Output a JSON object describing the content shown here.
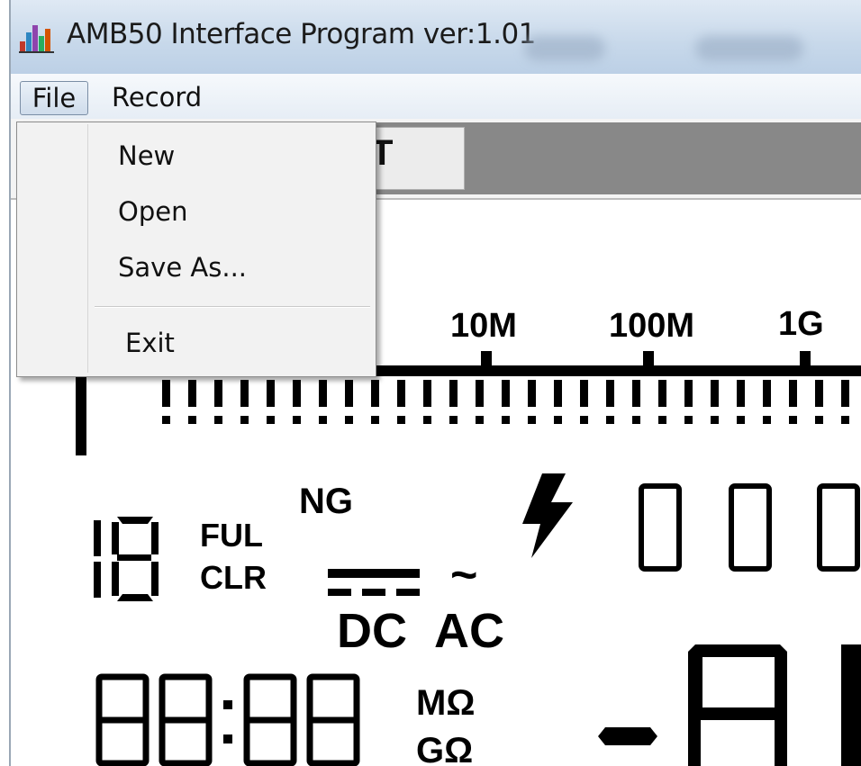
{
  "window": {
    "title": "AMB50 Interface Program ver:1.01",
    "icon": "bar-chart-icon"
  },
  "menubar": {
    "items": [
      {
        "label": "File",
        "active": true
      },
      {
        "label": "Record",
        "active": false
      }
    ]
  },
  "file_menu": {
    "items": [
      "New",
      "Open",
      "Save As...",
      "Exit"
    ]
  },
  "toolbar": {
    "partial_tab_text": "T"
  },
  "lcd": {
    "scale_labels": [
      "10M",
      "100M",
      "1G"
    ],
    "left_digits": "18",
    "ful_label": "FUL",
    "clr_label": "CLR",
    "ng_label": "NG",
    "dc_label": "DC",
    "ac_label": "AC",
    "tilde": "~",
    "time_display": "88:88",
    "unit_mohm": "MΩ",
    "unit_gohm": "GΩ",
    "right_digits": "000",
    "main_display": "-A"
  },
  "colors": {
    "titlebar": "#c7d8ea",
    "menubar": "#e6edf5",
    "gray_panel": "#888888",
    "lcd_ink": "#000000"
  }
}
